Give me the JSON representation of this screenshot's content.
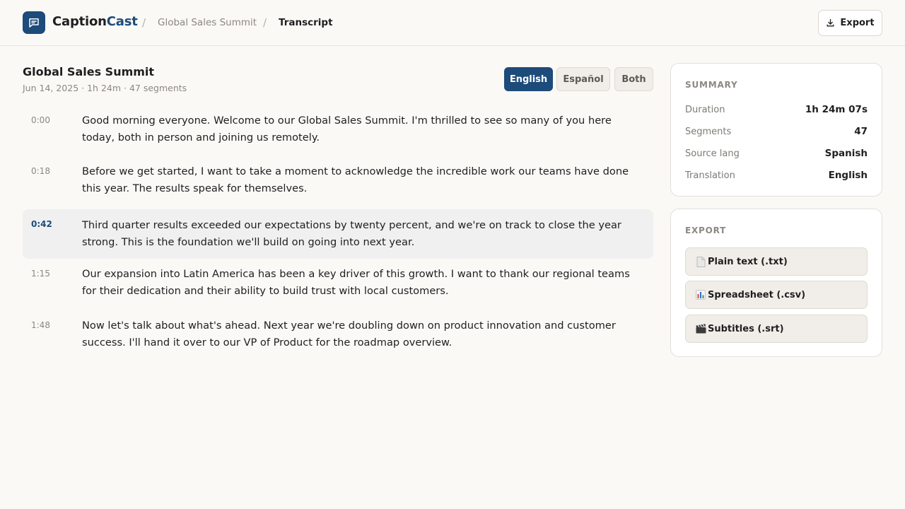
{
  "header": {
    "brand_part1": "Caption",
    "brand_part2": "Cast",
    "breadcrumb": [
      "Global Sales Summit",
      "Transcript"
    ],
    "separator": "/",
    "export_label": "Export"
  },
  "transcript": {
    "title": "Global Sales Summit",
    "meta": "Jun 14, 2025 · 1h 24m · 47 segments",
    "languages": [
      "English",
      "Español",
      "Both"
    ],
    "selected_language": "English",
    "segments": [
      {
        "time": "0:00",
        "text": "Good morning everyone. Welcome to our Global Sales Summit. I'm thrilled to see so many of you here today, both in person and joining us remotely."
      },
      {
        "time": "0:18",
        "text": "Before we get started, I want to take a moment to acknowledge the incredible work our teams have done this year. The results speak for themselves."
      },
      {
        "time": "0:42",
        "text": "Third quarter results exceeded our expectations by twenty percent, and we're on track to close the year strong. This is the foundation we'll build on going into next year.",
        "active": true
      },
      {
        "time": "1:15",
        "text": "Our expansion into Latin America has been a key driver of this growth. I want to thank our regional teams for their dedication and their ability to build trust with local customers."
      },
      {
        "time": "1:48",
        "text": "Now let's talk about what's ahead. Next year we're doubling down on product innovation and customer success. I'll hand it over to our VP of Product for the roadmap overview."
      }
    ]
  },
  "summary": {
    "title": "SUMMARY",
    "rows": [
      {
        "label": "Duration",
        "value": "1h 24m 07s"
      },
      {
        "label": "Segments",
        "value": "47"
      },
      {
        "label": "Source lang",
        "value": "Spanish"
      },
      {
        "label": "Translation",
        "value": "English"
      }
    ]
  },
  "export": {
    "title": "EXPORT",
    "options": [
      {
        "icon": "document-icon",
        "label": "Plain text (.txt)"
      },
      {
        "icon": "bar-chart-icon",
        "label": "Spreadsheet (.csv)"
      },
      {
        "icon": "clapperboard-icon",
        "label": "Subtitles (.srt)"
      }
    ]
  },
  "colors": {
    "accent": "#1d4b7a",
    "background": "#faf9f6",
    "active_segment": "#eff0ef"
  }
}
